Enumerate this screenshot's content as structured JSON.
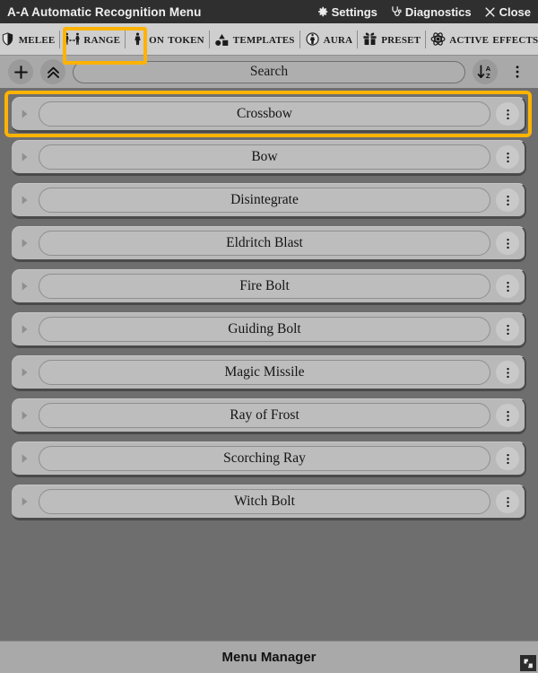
{
  "titlebar": {
    "title": "A-A Automatic Recognition Menu",
    "actions": [
      {
        "label": "Settings",
        "icon": "gear-icon"
      },
      {
        "label": "Diagnostics",
        "icon": "stethoscope-icon"
      },
      {
        "label": "Close",
        "icon": "close-icon"
      }
    ]
  },
  "toolbar": {
    "tabs": [
      {
        "label": "Melee",
        "icon": "shield-icon",
        "active": false
      },
      {
        "label": "Range",
        "icon": "range-icon",
        "active": true
      },
      {
        "label": "On Token",
        "icon": "token-figure-icon",
        "active": false
      },
      {
        "label": "Templates",
        "icon": "shapes-icon",
        "active": false
      },
      {
        "label": "Aura",
        "icon": "aura-icon",
        "active": false
      },
      {
        "label": "Preset",
        "icon": "gift-icon",
        "active": false
      },
      {
        "label": "Active Effects",
        "icon": "atom-icon",
        "active": false
      }
    ],
    "highlight_color": "#ffb300"
  },
  "searchbar": {
    "add_label": "+",
    "add_icon": "plus-icon",
    "collapse_icon": "double-chevron-up-icon",
    "search_placeholder": "Search",
    "search_value": "",
    "sort_icon": "sort-az-descending-icon",
    "overflow_icon": "kebab-menu-icon"
  },
  "list": {
    "expand_icon": "triangle-right-icon",
    "row_menu_icon": "kebab-menu-icon",
    "selected_index": 0,
    "items": [
      {
        "label": "Crossbow"
      },
      {
        "label": "Bow"
      },
      {
        "label": "Disintegrate"
      },
      {
        "label": "Eldritch Blast"
      },
      {
        "label": "Fire Bolt"
      },
      {
        "label": "Guiding Bolt"
      },
      {
        "label": "Magic Missile"
      },
      {
        "label": "Ray of Frost"
      },
      {
        "label": "Scorching Ray"
      },
      {
        "label": "Witch Bolt"
      }
    ]
  },
  "footer": {
    "title": "Menu Manager",
    "resize_icon": "resize-handle-icon"
  },
  "colors": {
    "accent": "#ffb300",
    "titlebar_bg": "#2f2f2f",
    "toolbar_bg": "#cfcfcf",
    "body_bg": "#6e6e6e",
    "row_bg": "#b9b9b9",
    "bar_bg": "#a9a9a9"
  }
}
